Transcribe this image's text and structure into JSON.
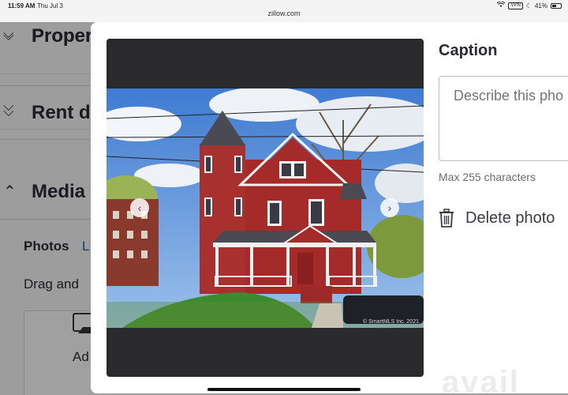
{
  "status_bar": {
    "time": "11:59 AM",
    "date": "Thu Jul 3",
    "vpn": "VPN",
    "battery": "41%"
  },
  "browser": {
    "url": "zillow.com"
  },
  "background": {
    "sections": [
      {
        "title": "Propert",
        "icon": "chevron-down-icon",
        "glyph": "⌵"
      },
      {
        "title": "Rent d",
        "icon": "chevron-down-icon",
        "glyph": "⌵"
      },
      {
        "title": "Media",
        "icon": "chevron-up-icon",
        "glyph": "∧"
      }
    ],
    "photos_label": "Photos",
    "photos_link": "L",
    "drag_text": "Drag and",
    "upload_label": "Ad"
  },
  "modal": {
    "caption_heading": "Caption",
    "caption_placeholder": "Describe this pho",
    "char_limit": "Max 255 characters",
    "delete_label": "Delete photo",
    "prev_icon": "chevron-left-icon",
    "next_icon": "chevron-right-icon",
    "watermark": "© SmartMLS Inc. 2021"
  },
  "logo_text": "avail",
  "colors": {
    "house_red": "#a52a2a",
    "sky": "#5b8fd6",
    "link": "#1a5fb4"
  }
}
